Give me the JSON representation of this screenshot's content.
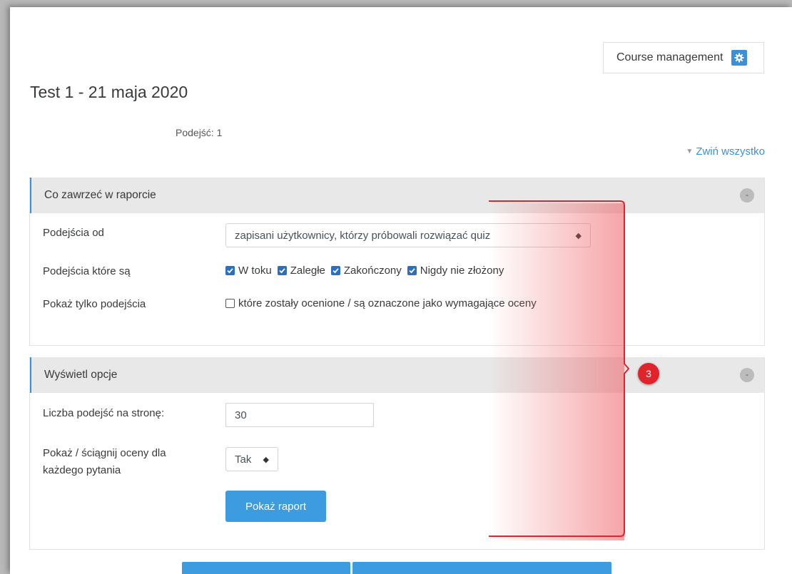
{
  "header": {
    "course_management_label": "Course management",
    "course_management_icon": "gear-icon",
    "title": "Test 1 - 21 maja 2020",
    "attempts_text": "Podejść: 1",
    "collapse_all_label": "Zwiń wszystko"
  },
  "report_section": {
    "title": "Co zawrzeć w raporcie",
    "toggle": "-",
    "attempts_from": {
      "label": "Podejścia od",
      "value": "zapisani użytkownicy, którzy próbowali rozwiązać quiz"
    },
    "attempts_that_are": {
      "label": "Podejścia które są",
      "options": [
        {
          "label": "W toku",
          "checked": true
        },
        {
          "label": "Zaległe",
          "checked": true
        },
        {
          "label": "Zakończony",
          "checked": true
        },
        {
          "label": "Nigdy nie złożony",
          "checked": true
        }
      ]
    },
    "show_only": {
      "label": "Pokaż tylko podejścia",
      "option_label": "które zostały ocenione / są oznaczone jako wymagające oceny",
      "checked": false
    }
  },
  "display_section": {
    "title": "Wyświetl opcje",
    "toggle": "-",
    "page_size": {
      "label": "Liczba podejść na stronę:",
      "value": "30"
    },
    "marks": {
      "label_line1": "Pokaż / ściągnij oceny dla",
      "label_line2": "każdego pytania",
      "value": "Tak"
    },
    "submit_label": "Pokaż raport"
  },
  "annotation": {
    "badge_number": "3",
    "color": "#e1242b"
  },
  "colors": {
    "accent": "#3d8fd6",
    "button": "#3d9be0",
    "checkbox": "#2a6fc0"
  }
}
